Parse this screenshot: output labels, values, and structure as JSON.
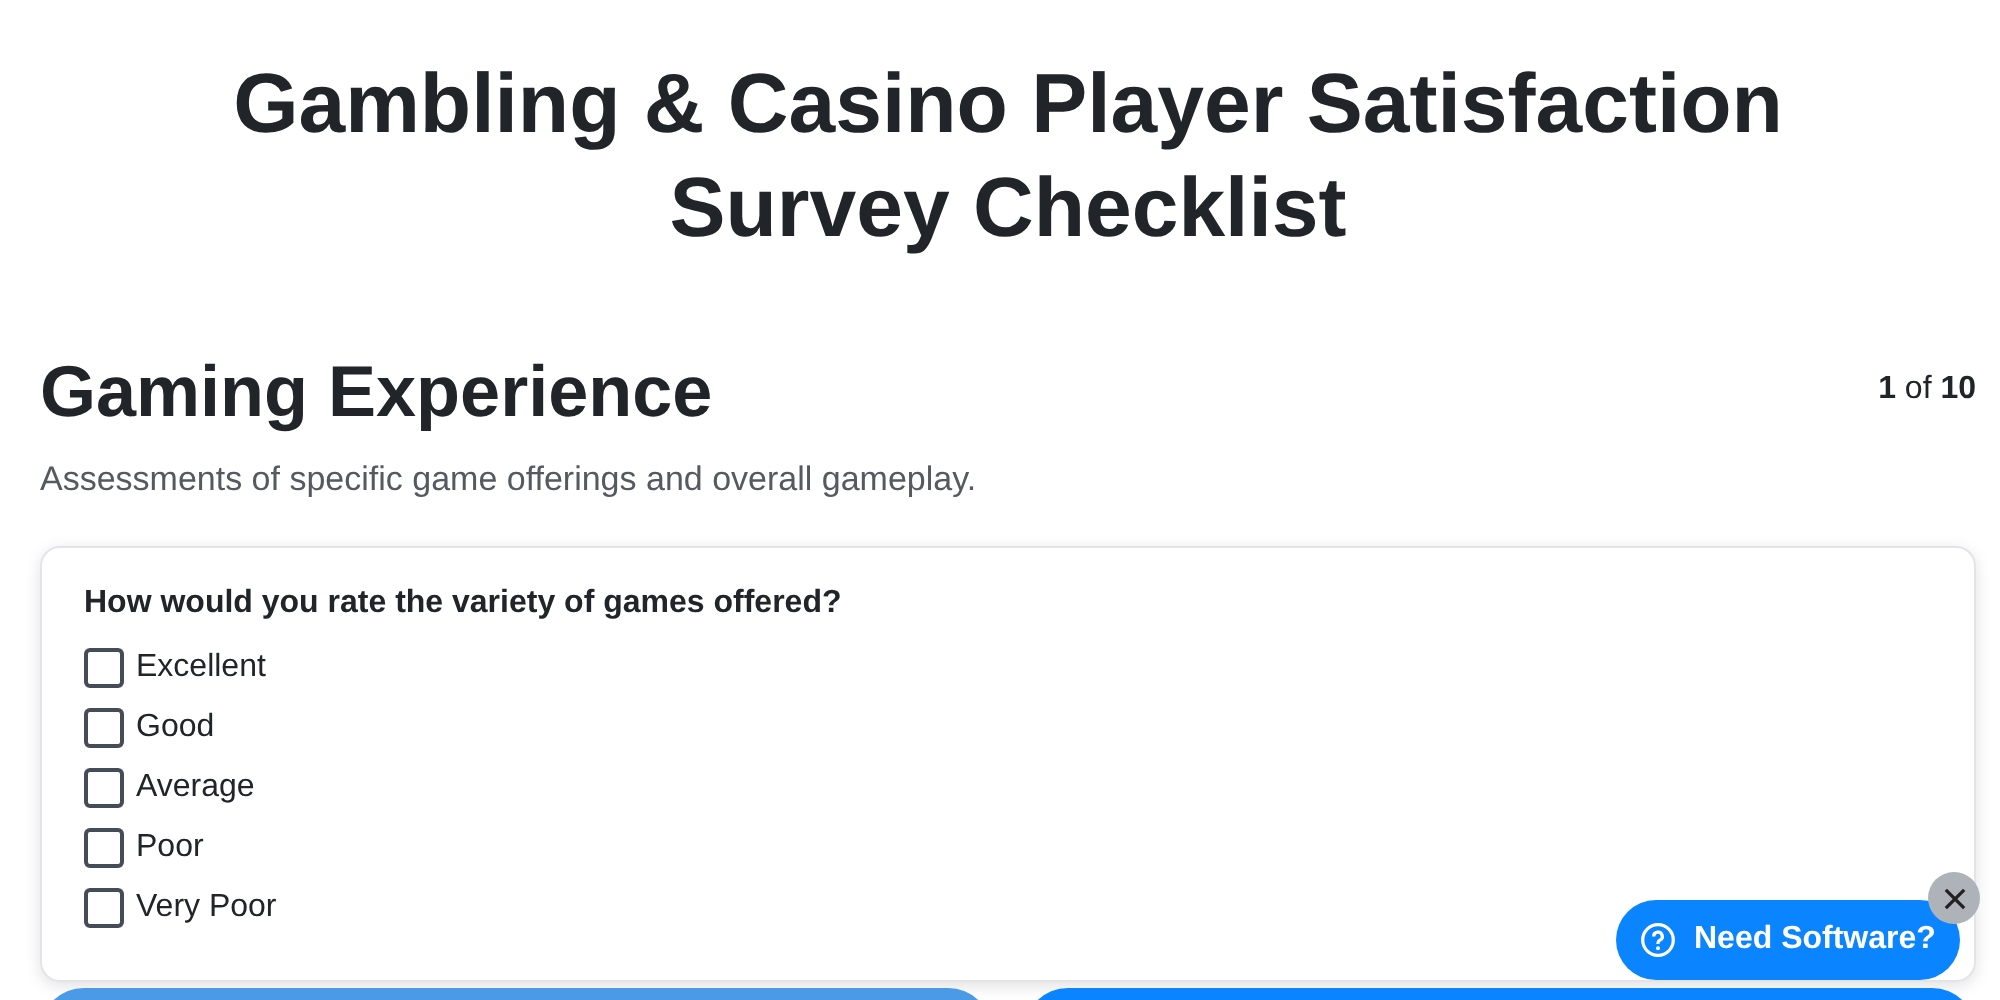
{
  "title": "Gambling & Casino Player Satisfaction Survey Checklist",
  "section": {
    "heading": "Gaming Experience",
    "counter": "**1** of **10**",
    "description": "Assessments of specific game offerings and overall gameplay."
  },
  "question": {
    "text": "How would you rate the variety of games offered?",
    "options": [
      {
        "label": "Excellent",
        "checked": false
      },
      {
        "label": "Good",
        "checked": false
      },
      {
        "label": "Average",
        "checked": false
      },
      {
        "label": "Poor",
        "checked": false
      },
      {
        "label": "Very Poor",
        "checked": false
      }
    ]
  },
  "nav_buttons": [
    {
      "kind": "secondary"
    },
    {
      "kind": "primary"
    }
  ],
  "help_widget": {
    "label": "Need Software?"
  }
}
